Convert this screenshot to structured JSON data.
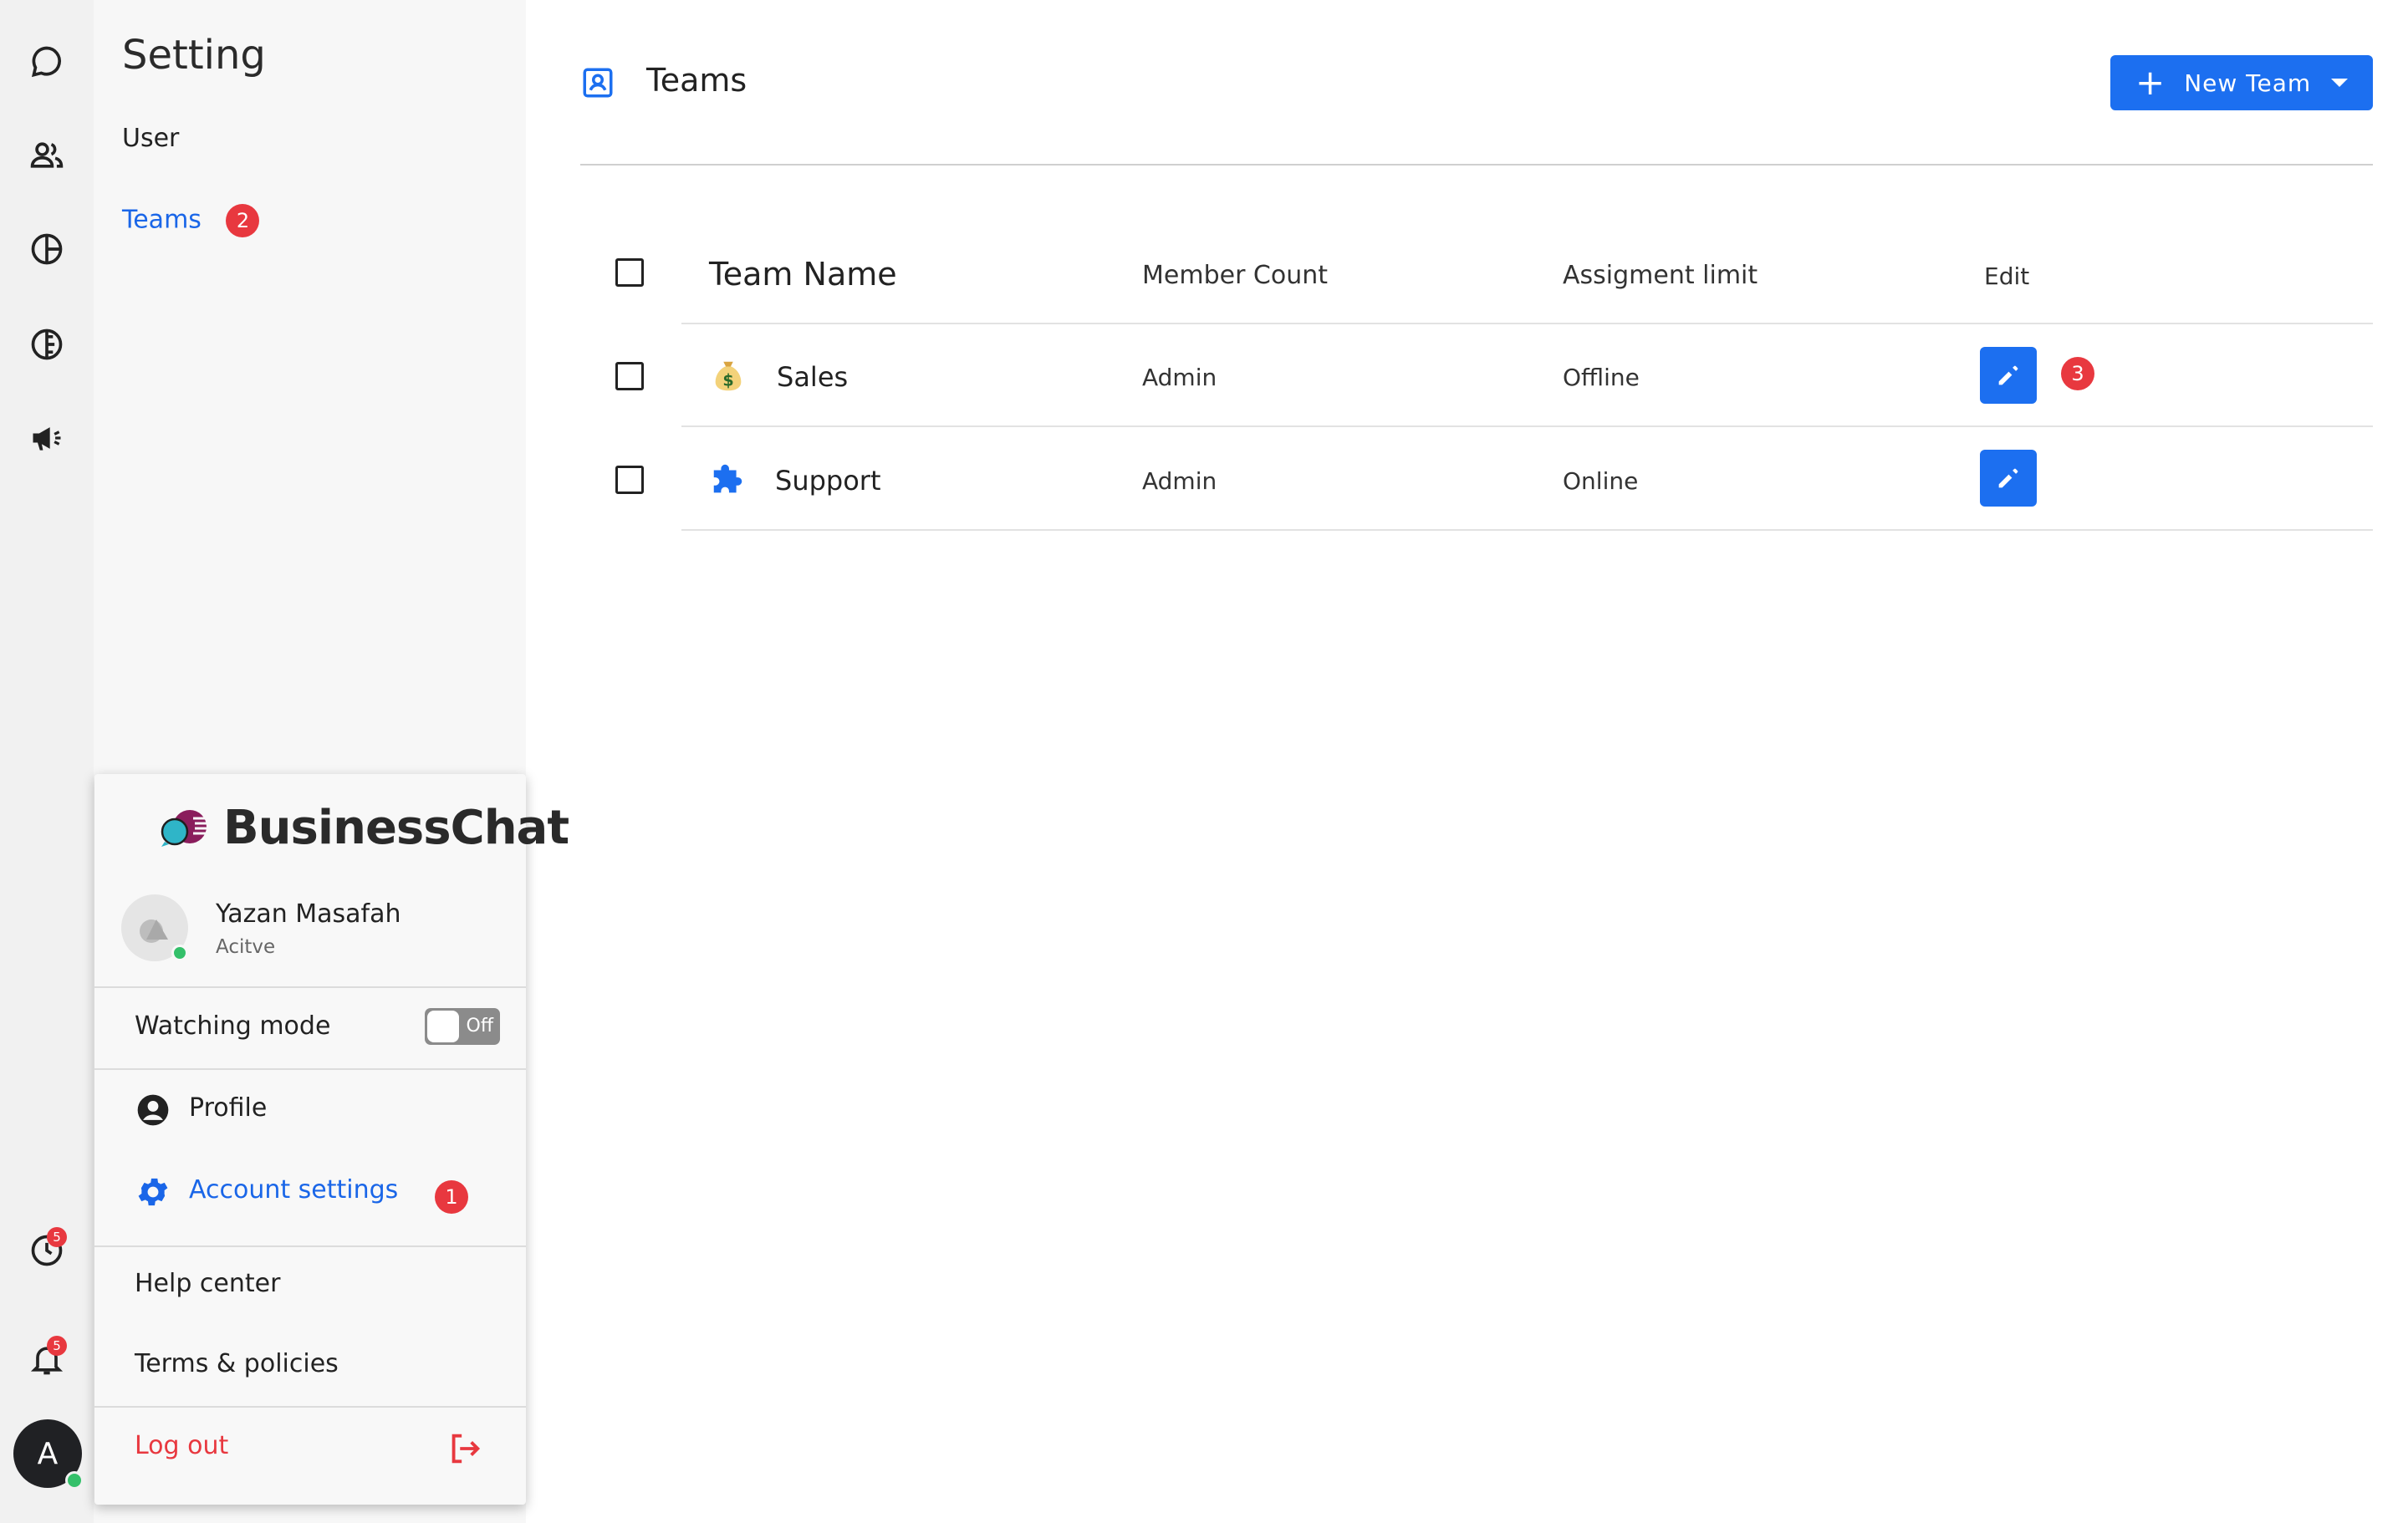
{
  "rail": {
    "icons": [
      "chat-bubble-icon",
      "contacts-icon",
      "reports-icon",
      "campaign-icon",
      "broadcast-icon"
    ],
    "bottom": {
      "activity_badge": "5",
      "notifications_badge": "5",
      "avatar_initial": "A"
    }
  },
  "sidebar": {
    "title": "Setting",
    "items": [
      {
        "label": "User",
        "active": false
      },
      {
        "label": "Teams",
        "active": true,
        "badge": "2"
      }
    ]
  },
  "header": {
    "title": "Teams",
    "new_team_label": "New Team"
  },
  "table": {
    "columns": [
      "Team Name",
      "Member Count",
      "Assigment limit",
      "Edit"
    ],
    "rows": [
      {
        "icon": "money-bag-icon",
        "name": "Sales",
        "member_count": "Admin",
        "assignment_limit": "Offline",
        "badge": "3"
      },
      {
        "icon": "puzzle-icon",
        "name": "Support",
        "member_count": "Admin",
        "assignment_limit": "Online"
      }
    ]
  },
  "popup": {
    "logo_text": "BusinessChat",
    "user": {
      "name": "Yazan Masafah",
      "status": "Acitve"
    },
    "watching_mode": {
      "label": "Watching mode",
      "toggle_label": "Off"
    },
    "profile_label": "Profile",
    "account_settings_label": "Account settings",
    "account_settings_badge": "1",
    "help_center_label": "Help center",
    "terms_label": "Terms & policies",
    "logout_label": "Log out"
  },
  "colors": {
    "accent": "#1c6ff0",
    "badge": "#e8383f",
    "online": "#34c06a"
  }
}
